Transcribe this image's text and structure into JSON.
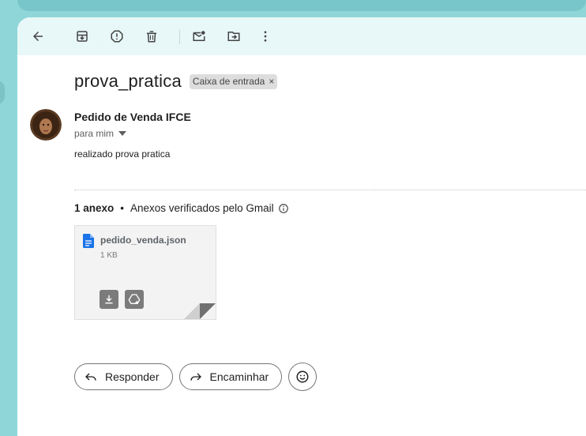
{
  "email": {
    "subject": "prova_pratica",
    "label": "Caixa de entrada",
    "label_remove": "×",
    "sender_name": "Pedido de Venda IFCE",
    "recipient": "para mim",
    "body": "realizado prova pratica"
  },
  "attachments": {
    "count_label": "1 anexo",
    "separator": "•",
    "verified_label": "Anexos verificados pelo Gmail",
    "files": [
      {
        "name": "pedido_venda.json",
        "size": "1 KB"
      }
    ]
  },
  "actions": {
    "reply_label": "Responder",
    "forward_label": "Encaminhar"
  },
  "icons": {
    "toolbar": [
      "back-arrow-icon",
      "archive-icon",
      "report-spam-icon",
      "delete-icon",
      "mark-unread-icon",
      "move-to-icon",
      "more-vert-icon"
    ],
    "accent_file": "#1a73e8"
  }
}
